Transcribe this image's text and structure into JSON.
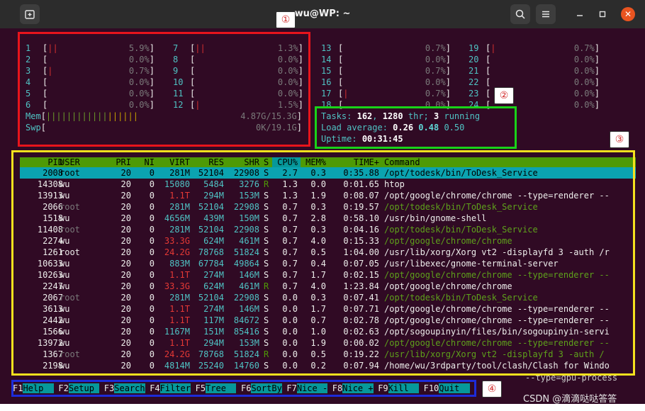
{
  "window": {
    "title": "wu@WP: ~",
    "tab_icon": "new-tab-icon"
  },
  "cpu_meters": {
    "left": [
      {
        "id": "1",
        "bar": "||",
        "pct": "5.9%"
      },
      {
        "id": "2",
        "bar": "",
        "pct": "0.0%"
      },
      {
        "id": "3",
        "bar": "|",
        "pct": "0.7%"
      },
      {
        "id": "4",
        "bar": "",
        "pct": "0.0%"
      },
      {
        "id": "5",
        "bar": "",
        "pct": "0.0%"
      },
      {
        "id": "6",
        "bar": "",
        "pct": "0.0%"
      }
    ],
    "mid": [
      {
        "id": "7",
        "bar": "||",
        "pct": "1.3%"
      },
      {
        "id": "8",
        "bar": "",
        "pct": "0.0%"
      },
      {
        "id": "9",
        "bar": "",
        "pct": "0.0%"
      },
      {
        "id": "10",
        "bar": "",
        "pct": "0.0%"
      },
      {
        "id": "11",
        "bar": "",
        "pct": "0.0%"
      },
      {
        "id": "12",
        "bar": "|",
        "pct": "1.5%"
      }
    ],
    "right_a": [
      {
        "id": "13",
        "bar": "",
        "pct": "0.7%"
      },
      {
        "id": "14",
        "bar": "",
        "pct": "0.0%"
      },
      {
        "id": "15",
        "bar": "",
        "pct": "0.7%"
      },
      {
        "id": "16",
        "bar": "",
        "pct": "0.0%"
      },
      {
        "id": "17",
        "bar": "|",
        "pct": "0.7%"
      },
      {
        "id": "18",
        "bar": "",
        "pct": "0.0%"
      }
    ],
    "right_b": [
      {
        "id": "19",
        "bar": "|",
        "pct": "0.7%"
      },
      {
        "id": "20",
        "bar": "",
        "pct": "0.0%"
      },
      {
        "id": "21",
        "bar": "",
        "pct": "0.0%"
      },
      {
        "id": "22",
        "bar": "",
        "pct": "0.0%"
      },
      {
        "id": "23",
        "bar": "",
        "pct": "0.0%"
      },
      {
        "id": "24",
        "bar": "",
        "pct": "0.0%"
      }
    ]
  },
  "mem": {
    "label": "Mem",
    "bar_green": "||||||||||||",
    "bar_yellow": "||||||",
    "value": "4.87G/15.3G"
  },
  "swp": {
    "label": "Swp",
    "value": "0K/19.1G"
  },
  "tasks": {
    "label": "Tasks:",
    "count": "162",
    "thr": "1280",
    "thr_label": "thr;",
    "running": "3",
    "running_label": "running"
  },
  "load": {
    "label": "Load average:",
    "v1": "0.26",
    "v2": "0.48",
    "v3": "0.50"
  },
  "uptime": {
    "label": "Uptime:",
    "value": "00:31:45"
  },
  "columns": [
    "PID",
    "USER",
    "PRI",
    "NI",
    "VIRT",
    "RES",
    "SHR",
    "S",
    "CPU%",
    "MEM%",
    "TIME+",
    "Command"
  ],
  "processes": [
    {
      "pid": "2008",
      "user": "root",
      "pri": "20",
      "ni": "0",
      "virt": "281M",
      "res": "52104",
      "shr": "22908",
      "s": "S",
      "cpu": "2.7",
      "mem": "0.3",
      "time": "0:35.88",
      "cmd": "/opt/todesk/bin/ToDesk_Service",
      "kind": "selected"
    },
    {
      "pid": "14308",
      "user": "wu",
      "pri": "20",
      "ni": "0",
      "virt": "15080",
      "res": "5484",
      "shr": "3276",
      "s": "R",
      "cpu": "1.3",
      "mem": "0.0",
      "time": "0:01.65",
      "cmd": "htop",
      "kind": "user"
    },
    {
      "pid": "13913",
      "user": "wu",
      "pri": "20",
      "ni": "0",
      "virt": "1.1T",
      "res": "294M",
      "shr": "153M",
      "s": "S",
      "cpu": "1.3",
      "mem": "1.9",
      "time": "0:08.07",
      "cmd": "/opt/google/chrome/chrome --type=renderer --",
      "kind": "user"
    },
    {
      "pid": "2066",
      "user": "root",
      "pri": "20",
      "ni": "0",
      "virt": "281M",
      "res": "52104",
      "shr": "22908",
      "s": "S",
      "cpu": "0.7",
      "mem": "0.3",
      "time": "0:19.57",
      "cmd": "/opt/todesk/bin/ToDesk_Service",
      "kind": "thread"
    },
    {
      "pid": "1518",
      "user": "wu",
      "pri": "20",
      "ni": "0",
      "virt": "4656M",
      "res": "439M",
      "shr": "150M",
      "s": "S",
      "cpu": "0.7",
      "mem": "2.8",
      "time": "0:58.10",
      "cmd": "/usr/bin/gnome-shell",
      "kind": "user"
    },
    {
      "pid": "11408",
      "user": "root",
      "pri": "20",
      "ni": "0",
      "virt": "281M",
      "res": "52104",
      "shr": "22908",
      "s": "S",
      "cpu": "0.7",
      "mem": "0.3",
      "time": "0:04.16",
      "cmd": "/opt/todesk/bin/ToDesk_Service",
      "kind": "thread"
    },
    {
      "pid": "2274",
      "user": "wu",
      "pri": "20",
      "ni": "0",
      "virt": "33.3G",
      "res": "624M",
      "shr": "461M",
      "s": "S",
      "cpu": "0.7",
      "mem": "4.0",
      "time": "0:15.33",
      "cmd": "/opt/google/chrome/chrome",
      "kind": "thread"
    },
    {
      "pid": "1261",
      "user": "root",
      "pri": "20",
      "ni": "0",
      "virt": "24.2G",
      "res": "78768",
      "shr": "51824",
      "s": "S",
      "cpu": "0.7",
      "mem": "0.5",
      "time": "1:04.00",
      "cmd": "/usr/lib/xorg/Xorg vt2 -displayfd 3 -auth /r",
      "kind": "rootuser"
    },
    {
      "pid": "10633",
      "user": "wu",
      "pri": "20",
      "ni": "0",
      "virt": "883M",
      "res": "67784",
      "shr": "49864",
      "s": "S",
      "cpu": "0.7",
      "mem": "0.4",
      "time": "0:07.05",
      "cmd": "/usr/libexec/gnome-terminal-server",
      "kind": "user"
    },
    {
      "pid": "10263",
      "user": "wu",
      "pri": "20",
      "ni": "0",
      "virt": "1.1T",
      "res": "274M",
      "shr": "146M",
      "s": "S",
      "cpu": "0.7",
      "mem": "1.7",
      "time": "0:02.15",
      "cmd": "/opt/google/chrome/chrome --type=renderer --",
      "kind": "thread"
    },
    {
      "pid": "2247",
      "user": "wu",
      "pri": "20",
      "ni": "0",
      "virt": "33.3G",
      "res": "624M",
      "shr": "461M",
      "s": "R",
      "cpu": "0.7",
      "mem": "4.0",
      "time": "1:23.84",
      "cmd": "/opt/google/chrome/chrome",
      "kind": "user"
    },
    {
      "pid": "2067",
      "user": "root",
      "pri": "20",
      "ni": "0",
      "virt": "281M",
      "res": "52104",
      "shr": "22908",
      "s": "S",
      "cpu": "0.0",
      "mem": "0.3",
      "time": "0:07.41",
      "cmd": "/opt/todesk/bin/ToDesk_Service",
      "kind": "thread"
    },
    {
      "pid": "3613",
      "user": "wu",
      "pri": "20",
      "ni": "0",
      "virt": "1.1T",
      "res": "274M",
      "shr": "146M",
      "s": "S",
      "cpu": "0.0",
      "mem": "1.7",
      "time": "0:07.71",
      "cmd": "/opt/google/chrome/chrome --type=renderer --",
      "kind": "user"
    },
    {
      "pid": "2442",
      "user": "wu",
      "pri": "20",
      "ni": "0",
      "virt": "1.1T",
      "res": "117M",
      "shr": "84672",
      "s": "S",
      "cpu": "0.0",
      "mem": "0.7",
      "time": "0:02.78",
      "cmd": "/opt/google/chrome/chrome --type=renderer --",
      "kind": "user"
    },
    {
      "pid": "1566",
      "user": "wu",
      "pri": "20",
      "ni": "0",
      "virt": "1167M",
      "res": "151M",
      "shr": "85416",
      "s": "S",
      "cpu": "0.0",
      "mem": "1.0",
      "time": "0:02.63",
      "cmd": "/opt/sogoupinyin/files/bin/sogoupinyin-servi",
      "kind": "user"
    },
    {
      "pid": "13972",
      "user": "wu",
      "pri": "20",
      "ni": "0",
      "virt": "1.1T",
      "res": "294M",
      "shr": "153M",
      "s": "S",
      "cpu": "0.0",
      "mem": "1.9",
      "time": "0:00.02",
      "cmd": "/opt/google/chrome/chrome --type=renderer --",
      "kind": "thread"
    },
    {
      "pid": "1367",
      "user": "root",
      "pri": "20",
      "ni": "0",
      "virt": "24.2G",
      "res": "78768",
      "shr": "51824",
      "s": "R",
      "cpu": "0.0",
      "mem": "0.5",
      "time": "0:19.22",
      "cmd": "/usr/lib/xorg/Xorg vt2 -displayfd 3 -auth /",
      "kind": "thread"
    },
    {
      "pid": "2198",
      "user": "wu",
      "pri": "20",
      "ni": "0",
      "virt": "4814M",
      "res": "25240",
      "shr": "14760",
      "s": "S",
      "cpu": "0.0",
      "mem": "0.2",
      "time": "0:07.94",
      "cmd": "/home/wu/3rdparty/tool/clash/Clash for Windo",
      "kind": "user"
    }
  ],
  "peek_cmd": "--type=gpu-process",
  "fkeys": [
    {
      "key": "F1",
      "label": "Help  "
    },
    {
      "key": "F2",
      "label": "Setup "
    },
    {
      "key": "F3",
      "label": "Search"
    },
    {
      "key": "F4",
      "label": "Filter"
    },
    {
      "key": "F5",
      "label": "Tree  "
    },
    {
      "key": "F6",
      "label": "SortBy"
    },
    {
      "key": "F7",
      "label": "Nice -"
    },
    {
      "key": "F8",
      "label": "Nice +"
    },
    {
      "key": "F9",
      "label": "Kill  "
    },
    {
      "key": "F10",
      "label": "Quit  "
    }
  ],
  "annotations": {
    "a1": "①",
    "a2": "②",
    "a3": "③",
    "a4": "④"
  },
  "watermark": "CSDN @滴滴哒哒答答",
  "colors": {
    "box1": "#e8141c",
    "box2": "#19d219",
    "box3": "#f5e11e",
    "box4": "#1d2bd9"
  }
}
